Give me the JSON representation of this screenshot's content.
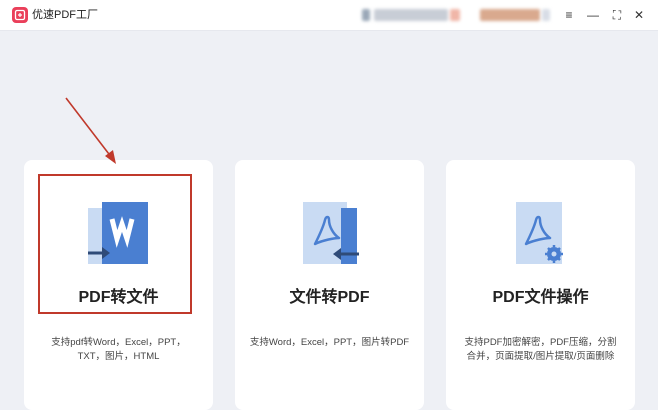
{
  "window": {
    "title": "优速PDF工厂",
    "controls": {
      "menu_icon": "≡",
      "minimize_icon": "—",
      "maximize_icon": "⛶",
      "close_icon": "✕"
    }
  },
  "cards": [
    {
      "title": "PDF转文件",
      "description": "支持pdf转Word，Excel，PPT，TXT，图片，HTML",
      "icon": "pdf-to-word-icon"
    },
    {
      "title": "文件转PDF",
      "description": "支持Word，Excel，PPT，图片转PDF",
      "icon": "file-to-pdf-icon"
    },
    {
      "title": "PDF文件操作",
      "description": "支持PDF加密解密，PDF压缩，分割合并，页面提取/图片提取/页面删除",
      "icon": "pdf-operations-icon"
    }
  ],
  "colors": {
    "accent_blue": "#4a7fd1",
    "light_blue": "#c9dbf3",
    "annotation_red": "#c0392b",
    "logo_red": "#ea3f5a"
  }
}
